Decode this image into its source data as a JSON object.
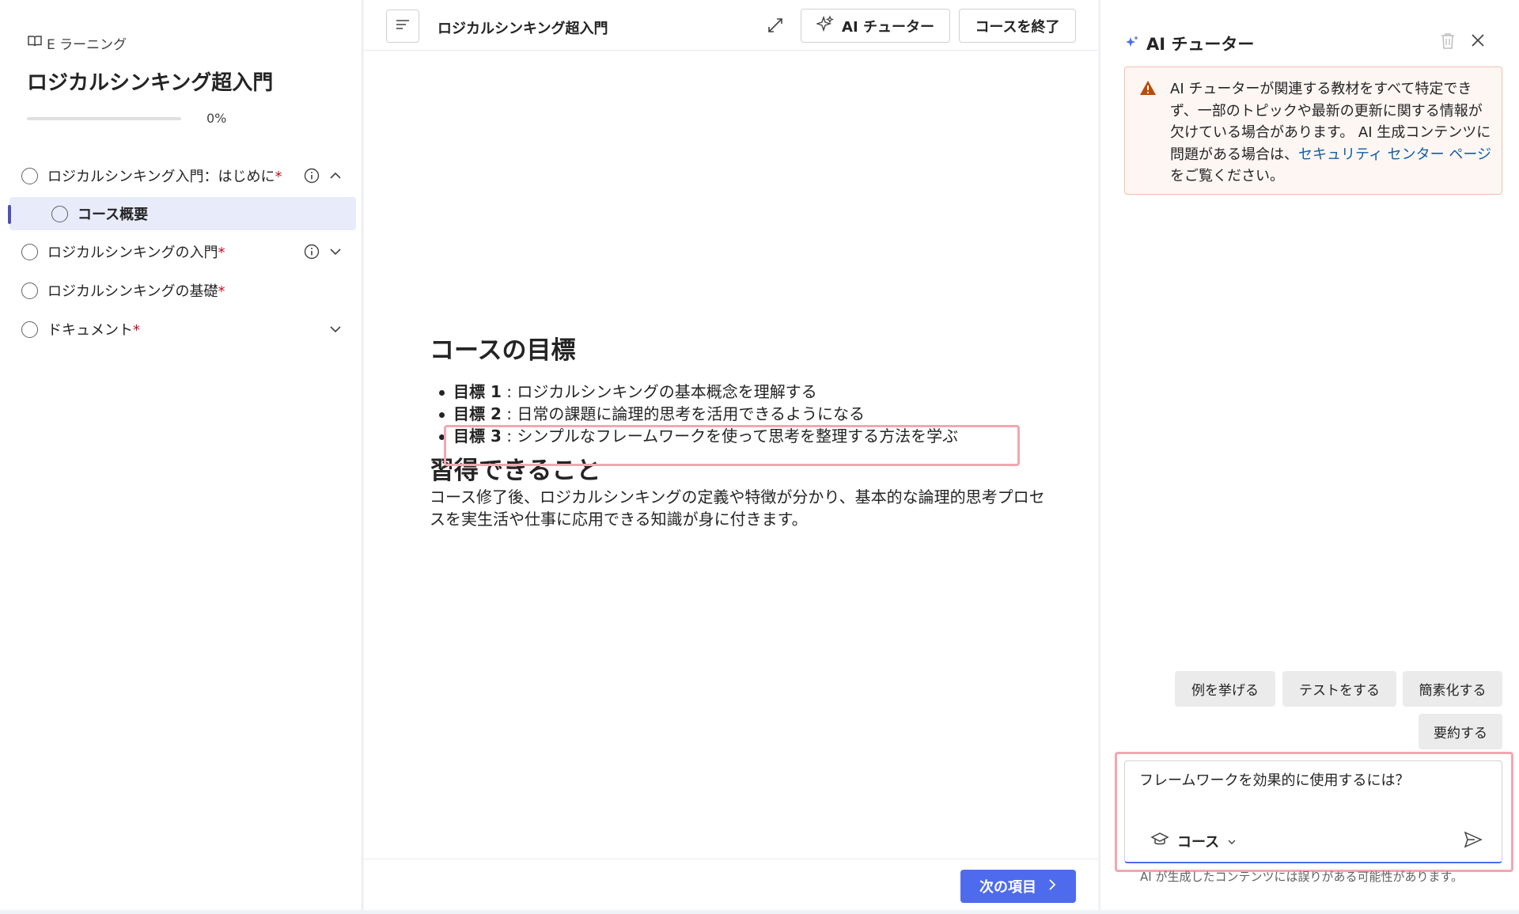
{
  "sidebar": {
    "brand": "E ラーニング",
    "course_title": "ロジカルシンキング超入門",
    "progress_percent": 0,
    "progress_label": "0%",
    "items": [
      {
        "label": "ロジカルシンキング入門：はじめに",
        "required": "*"
      },
      {
        "label": "コース概要"
      },
      {
        "label": "ロジカルシンキングの入門",
        "required": "*"
      },
      {
        "label": "ロジカルシンキングの基礎",
        "required": "*"
      },
      {
        "label": "ドキュメント",
        "required": "*"
      }
    ]
  },
  "main": {
    "title": "ロジカルシンキング超入門",
    "tutor_button": "AI チューター",
    "end_button": "コースを終了",
    "goal_heading": "コースの目標",
    "goals": [
      {
        "label": "目標 1",
        "text": " : ロジカルシンキングの基本概念を理解する"
      },
      {
        "label": "目標 2",
        "text": " : 日常の課題に論理的思考を活用できるようになる"
      },
      {
        "label": "目標 3",
        "text": " : シンプルなフレームワークを使って思考を整理する方法を学ぶ"
      }
    ],
    "learn_heading": "習得できること",
    "learn_text": "コース修了後、ロジカルシンキングの定義や特徴が分かり、基本的な論理的思考プロセスを実生活や仕事に応用できる知識が身に付きます。",
    "next_button": "次の項目"
  },
  "panel": {
    "title": "AI チューター",
    "warning_text": "AI チューターが関連する教材をすべて特定できず、一部のトピックや最新の更新に関する情報が欠けている場合があります。 AI 生成コンテンツに問題がある場合は、",
    "warning_link": "セキュリティ センター ページ",
    "warning_suffix": " をご覧ください。",
    "chips": [
      "例を挙げる",
      "テストをする",
      "簡素化する",
      "要約する"
    ],
    "input_value": "フレームワークを効果的に使用するには？",
    "scope_label": "コース",
    "disclaimer": "AI が生成したコンテンツには誤りがある可能性があります。"
  },
  "colors": {
    "accent": "#4f6bed",
    "highlight": "#f4a6b0",
    "warning_bg": "#fdf6f3",
    "warning_icon": "#bc4b09",
    "link": "#115ea3"
  }
}
